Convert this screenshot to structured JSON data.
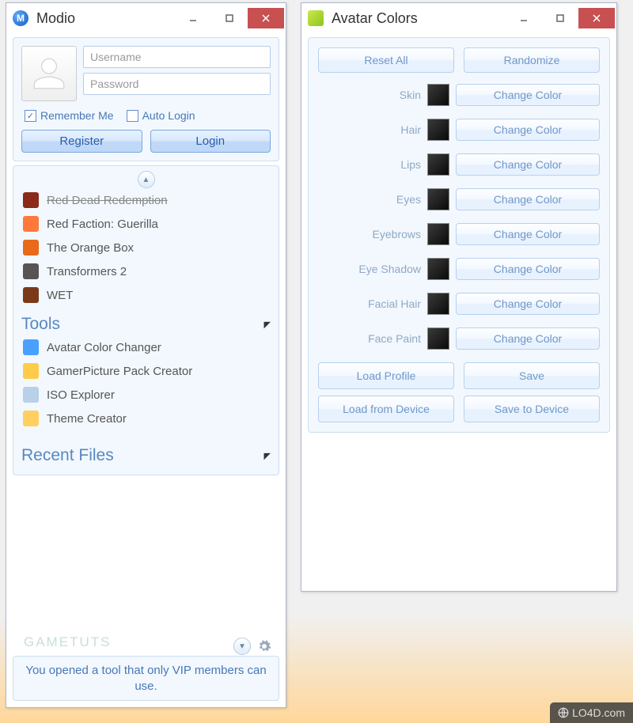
{
  "modio": {
    "title": "Modio",
    "username_placeholder": "Username",
    "password_placeholder": "Password",
    "remember_label": "Remember Me",
    "remember_checked": true,
    "autologin_label": "Auto Login",
    "autologin_checked": false,
    "register_label": "Register",
    "login_label": "Login",
    "games": [
      {
        "name": "Red Dead Redemption",
        "color": "#8c2a1a"
      },
      {
        "name": "Red Faction: Guerilla",
        "color": "#ff7a3a"
      },
      {
        "name": "The Orange Box",
        "color": "#e86a1a"
      },
      {
        "name": "Transformers 2",
        "color": "#555555"
      },
      {
        "name": "WET",
        "color": "#7a3a1a"
      }
    ],
    "tools_header": "Tools",
    "tools": [
      {
        "name": "Avatar Color Changer",
        "color": "#4aa0ff"
      },
      {
        "name": "GamerPicture Pack Creator",
        "color": "#ffcc4a"
      },
      {
        "name": "ISO Explorer",
        "color": "#b8d0e8"
      },
      {
        "name": "Theme Creator",
        "color": "#ffd060"
      }
    ],
    "recent_header": "Recent Files",
    "watermark": "GAMETUTS",
    "status_message": "You opened a tool that only VIP members can use."
  },
  "avatar": {
    "title": "Avatar Colors",
    "reset_label": "Reset All",
    "randomize_label": "Randomize",
    "change_label": "Change Color",
    "parts": [
      "Skin",
      "Hair",
      "Lips",
      "Eyes",
      "Eyebrows",
      "Eye Shadow",
      "Facial Hair",
      "Face Paint"
    ],
    "load_profile": "Load Profile",
    "save": "Save",
    "load_device": "Load from Device",
    "save_device": "Save to Device"
  },
  "badge": "LO4D.com"
}
